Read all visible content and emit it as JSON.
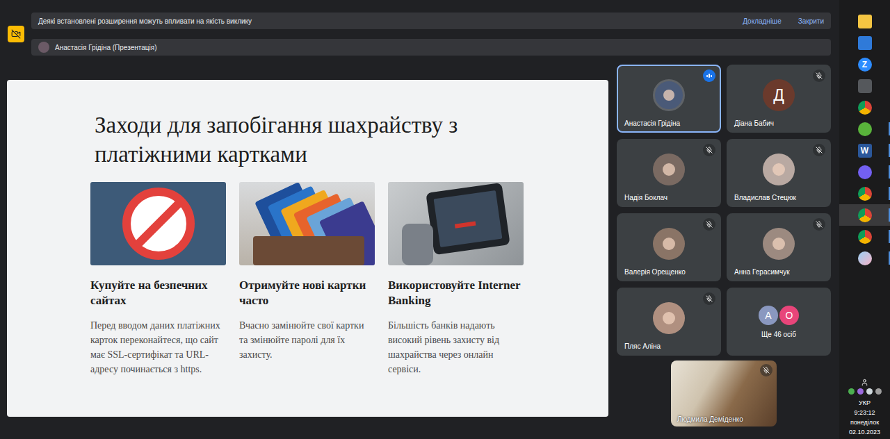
{
  "notification": {
    "text": "Деякі встановлені розширення можуть впливати на якість виклику",
    "links": [
      "Докладніше",
      "Закрити"
    ]
  },
  "presenter": {
    "label": "Анастасія Грідіна (Презентація)"
  },
  "slide": {
    "title": "Заходи для запобігання шахрайству з платіжними картками",
    "cards": [
      {
        "kind": "prohibition",
        "heading": "Купуйте на безпечних сайтах",
        "body": "Перед вводом даних платіжних карток переконайтеся, що сайт має SSL-сертифікат та URL-адресу починається з https."
      },
      {
        "kind": "cards",
        "heading": "Отримуйте нові картки часто",
        "body": "Вчасно замінюйте свої картки та змінюйте паролі для їх захисту."
      },
      {
        "kind": "tablet",
        "heading": "Використовуйте Interner Banking",
        "body": "Більшість банків надають високий рівень захисту від шахрайства через онлайн сервіси."
      }
    ]
  },
  "participants": [
    {
      "name": "Анастасія Грідіна",
      "kind": "photo",
      "initial": "",
      "muted": false,
      "speaking": true,
      "color": "#4a5a78"
    },
    {
      "name": "Діана Бабич",
      "kind": "initial",
      "initial": "Д",
      "muted": true,
      "speaking": false,
      "color": "#6b3a2c"
    },
    {
      "name": "Надія Боклач",
      "kind": "photo",
      "initial": "",
      "muted": true,
      "speaking": false,
      "color": "#7a6a62"
    },
    {
      "name": "Владислав Стецюк",
      "kind": "photo",
      "initial": "",
      "muted": true,
      "speaking": false,
      "color": "#b9a9a2"
    },
    {
      "name": "Валерія Орещенко",
      "kind": "photo",
      "initial": "",
      "muted": true,
      "speaking": false,
      "color": "#8a7466"
    },
    {
      "name": "Анна Герасимчук",
      "kind": "photo",
      "initial": "",
      "muted": true,
      "speaking": false,
      "color": "#9c8a80"
    },
    {
      "name": "Пляс Аліна",
      "kind": "photo",
      "initial": "",
      "muted": true,
      "speaking": false,
      "color": "#b09080"
    }
  ],
  "more": {
    "label": "Ще 46 осіб",
    "avatars": [
      {
        "initial": "А",
        "color": "#8a98c0"
      },
      {
        "initial": "О",
        "color": "#e8457a"
      }
    ]
  },
  "self_view": {
    "name": "Людмила Деміденко",
    "muted": true
  },
  "taskbar": {
    "apps": [
      {
        "kind": "explorer",
        "label": "",
        "active": false,
        "running": false
      },
      {
        "kind": "store",
        "label": "",
        "active": false,
        "running": false
      },
      {
        "kind": "zoom",
        "label": "Z",
        "active": false,
        "running": false
      },
      {
        "kind": "bear",
        "label": "",
        "active": false,
        "running": false
      },
      {
        "kind": "chrome",
        "label": "",
        "active": false,
        "running": false
      },
      {
        "kind": "torrent",
        "label": "",
        "active": false,
        "running": true
      },
      {
        "kind": "word",
        "label": "W",
        "active": false,
        "running": true
      },
      {
        "kind": "viber",
        "label": "",
        "active": false,
        "running": true
      },
      {
        "kind": "chrome",
        "label": "",
        "active": false,
        "running": true
      },
      {
        "kind": "chrome",
        "label": "",
        "active": true,
        "running": true
      },
      {
        "kind": "chrome",
        "label": "",
        "active": false,
        "running": true
      },
      {
        "kind": "paint",
        "label": "",
        "active": false,
        "running": true
      }
    ],
    "tray": {
      "language": "УКР",
      "time": "9:23:12",
      "day": "понеділок",
      "date": "02.10.2023"
    }
  }
}
